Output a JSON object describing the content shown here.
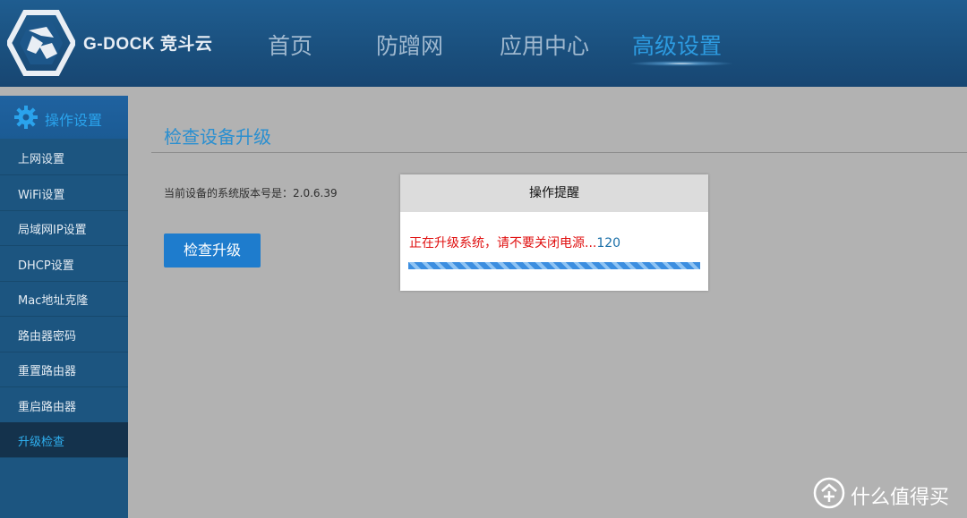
{
  "header": {
    "brand": "G-DOCK 竞斗云",
    "nav": [
      {
        "label": "首页",
        "active": false
      },
      {
        "label": "防蹭网",
        "active": false
      },
      {
        "label": "应用中心",
        "active": false
      },
      {
        "label": "高级设置",
        "active": true
      }
    ]
  },
  "sidebar": {
    "title": "操作设置",
    "title_icon": "gear-icon",
    "items": [
      {
        "label": "上网设置",
        "active": false
      },
      {
        "label": "WiFi设置",
        "active": false
      },
      {
        "label": "局域网IP设置",
        "active": false
      },
      {
        "label": "DHCP设置",
        "active": false
      },
      {
        "label": "Mac地址克隆",
        "active": false
      },
      {
        "label": "路由器密码",
        "active": false
      },
      {
        "label": "重置路由器",
        "active": false
      },
      {
        "label": "重启路由器",
        "active": false
      },
      {
        "label": "升级检查",
        "active": true
      }
    ]
  },
  "main": {
    "title": "检查设备升级",
    "version_text": "当前设备的系统版本号是：2.0.6.39",
    "check_button": "检查升级"
  },
  "dialog": {
    "title": "操作提醒",
    "message": "正在升级系统，请不要关闭电源...",
    "countdown": "120",
    "progress": 1.0
  },
  "watermark": {
    "icon": "smzdm-logo-icon",
    "text": "什么值得买"
  },
  "colors": {
    "header_bg": "#1a4f7d",
    "sidebar_bg": "#1c5580",
    "accent": "#2a8fd0",
    "button": "#1e7ccd",
    "warning_text": "#e01010"
  }
}
